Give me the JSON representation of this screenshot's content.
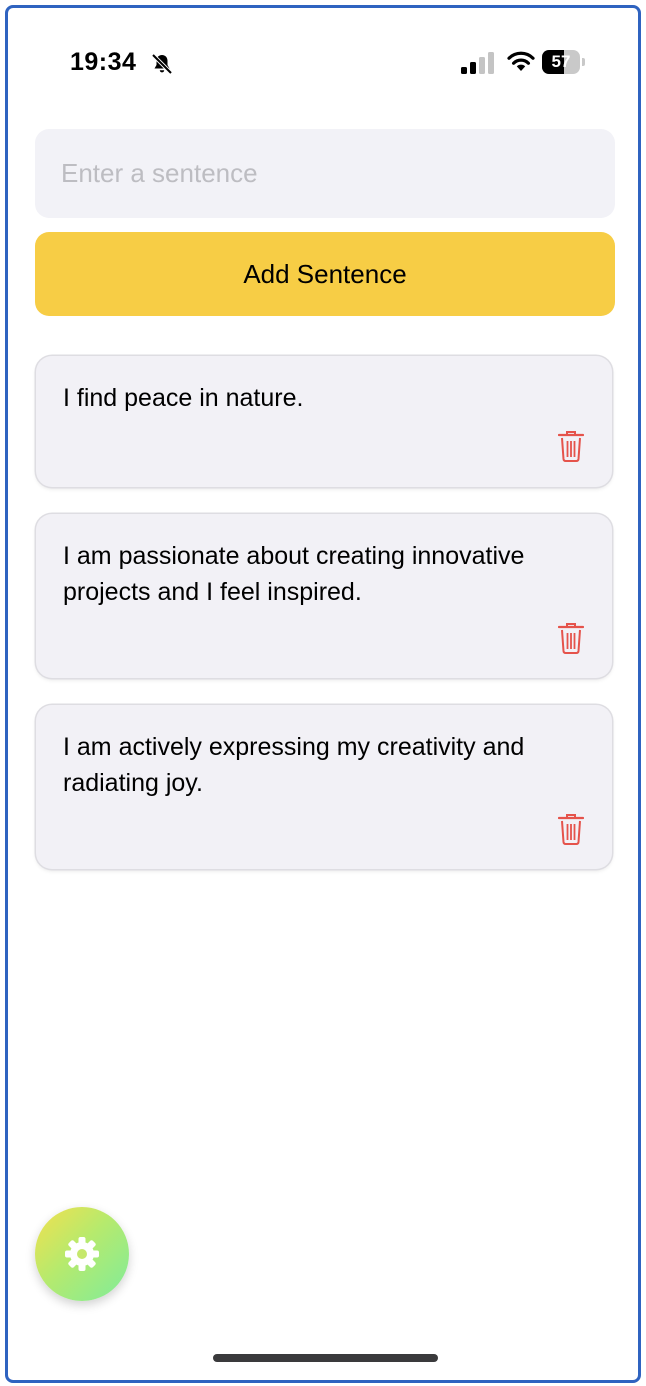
{
  "status_bar": {
    "time": "19:34",
    "battery_level": "57",
    "battery_fraction": 0.57,
    "icons": [
      "bell-slash-icon",
      "signal-icon",
      "wifi-icon",
      "battery-icon"
    ]
  },
  "input": {
    "placeholder": "Enter a sentence",
    "value": ""
  },
  "add_button": {
    "label": "Add Sentence",
    "color": "#f7cd45"
  },
  "sentences": [
    {
      "text": "I find peace in nature."
    },
    {
      "text": "I am passionate about creating innovative projects and I feel inspired."
    },
    {
      "text": "I am actively expressing my creativity and radiating joy."
    }
  ],
  "colors": {
    "card_background": "#f2f1f6",
    "delete_icon": "#e5534b",
    "frame_border": "#2f63c0"
  },
  "settings_fab": {
    "icon": "gear-icon"
  }
}
